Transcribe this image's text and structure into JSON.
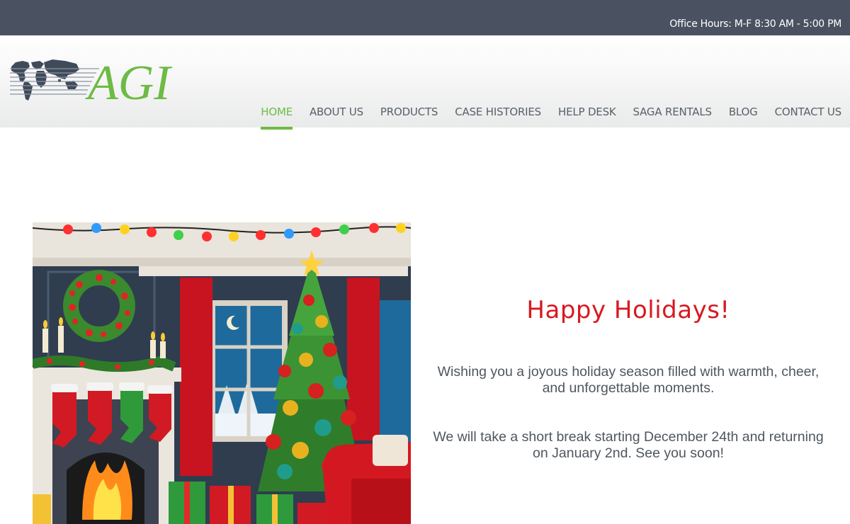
{
  "topbar": {
    "office_hours": "Office Hours: M-F 8:30 AM - 5:00 PM"
  },
  "logo": {
    "text": "AGI"
  },
  "nav": {
    "items": [
      {
        "label": "HOME",
        "active": true
      },
      {
        "label": "ABOUT US"
      },
      {
        "label": "PRODUCTS"
      },
      {
        "label": "CASE HISTORIES"
      },
      {
        "label": "HELP DESK"
      },
      {
        "label": "SAGA RENTALS"
      },
      {
        "label": "BLOG"
      },
      {
        "label": "CONTACT US"
      }
    ]
  },
  "main": {
    "heading": "Happy Holidays!",
    "paragraph1": "Wishing you a joyous holiday season filled with warmth, cheer, and unforgettable moments.",
    "paragraph2": "We will take a short break starting December 24th and returning on January 2nd. See you soon!"
  },
  "colors": {
    "topbar_bg": "#4a5261",
    "brand_green": "#6dbb45",
    "heading_red": "#d71920",
    "nav_text": "#59606b"
  }
}
